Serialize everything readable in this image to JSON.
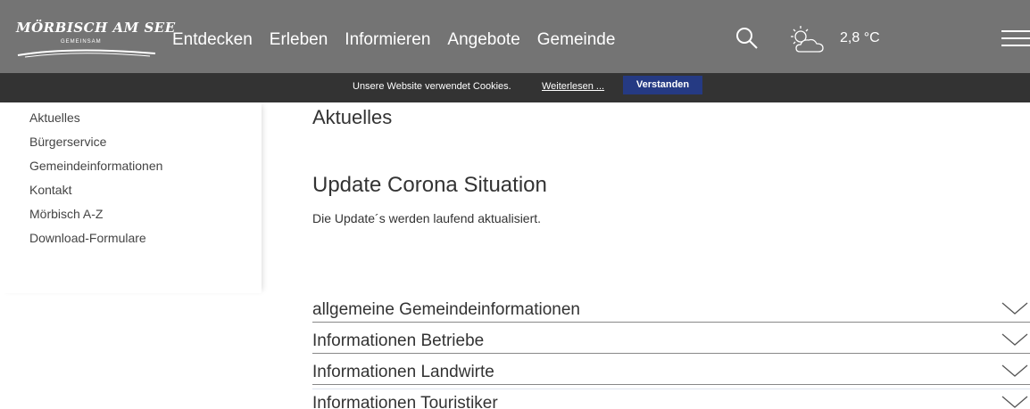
{
  "logo": {
    "text": "MÖRBISCH AM SEE",
    "tagline": "GEMEINSAM"
  },
  "nav": {
    "items": [
      "Entdecken",
      "Erleben",
      "Informieren",
      "Angebote",
      "Gemeinde"
    ]
  },
  "weather": {
    "icon": "partly-sunny-icon",
    "temperature": "2,8 °C"
  },
  "cookie": {
    "message": "Unsere Website verwendet Cookies.",
    "link_label": "Weiterlesen ...",
    "button_label": "Verstanden",
    "button_color": "#253a83"
  },
  "sidebar": {
    "items": [
      "Aktuelles",
      "Bürgerservice",
      "Gemeindeinformationen",
      "Kontakt",
      "Mörbisch A-Z",
      "Download-Formulare"
    ]
  },
  "main": {
    "title": "Aktuelles",
    "section_title": "Update Corona Situation",
    "section_text": "Die Update´s werden laufend aktualisiert.",
    "accordion": [
      "allgemeine Gemeindeinformationen",
      "Informationen Betriebe",
      "Informationen Landwirte",
      "Informationen Touristiker"
    ]
  },
  "colors": {
    "header_bg": "#747474",
    "cookie_bg": "#333333"
  }
}
